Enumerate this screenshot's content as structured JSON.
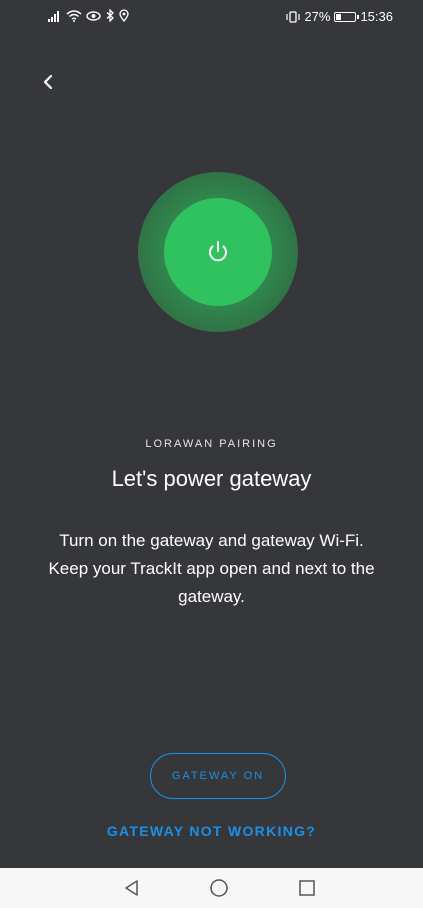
{
  "status_bar": {
    "battery_percent": "27%",
    "battery_level": 0.27,
    "time": "15:36",
    "left_icons": [
      "signal-icon",
      "wifi-icon",
      "eye-icon",
      "bluetooth-icon",
      "location-icon"
    ],
    "right_icons": [
      "vibrate-icon",
      "battery-icon"
    ]
  },
  "header": {
    "back_icon": "chevron-left-icon"
  },
  "hero": {
    "icon": "power-icon",
    "glow_color": "#2fc25e"
  },
  "content": {
    "eyebrow": "LORAWAN PAIRING",
    "title": "Let's power gateway",
    "description": "Turn on the gateway and gateway Wi-Fi. Keep your TrackIt app open and next to the gateway."
  },
  "actions": {
    "gateway_on_label": "GATEWAY ON",
    "not_working_label": "GATEWAY NOT WORKING?",
    "accent_color": "#1a91e6"
  },
  "nav_bar": {
    "buttons": [
      "back-triangle-icon",
      "home-circle-icon",
      "recents-square-icon"
    ]
  }
}
